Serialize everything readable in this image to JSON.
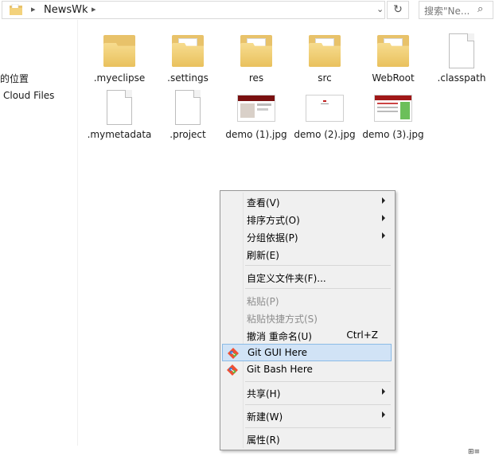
{
  "address": {
    "path_segment": "NewsWk",
    "sep": "▸",
    "dropdown": "⌄",
    "refresh": "↻",
    "search_placeholder": "搜索\"Ne...",
    "search_icon": "⌕"
  },
  "nav": {
    "items": [
      "的位置",
      "Cloud Files"
    ]
  },
  "files": [
    {
      "name": ".myeclipse",
      "type": "folder"
    },
    {
      "name": ".settings",
      "type": "folder"
    },
    {
      "name": "res",
      "type": "folder"
    },
    {
      "name": "src",
      "type": "folder"
    },
    {
      "name": "WebRoot",
      "type": "folder"
    },
    {
      "name": ".classpath",
      "type": "file"
    },
    {
      "name": ".mymetadata",
      "type": "file"
    },
    {
      "name": ".project",
      "type": "file"
    },
    {
      "name": "demo (1).jpg",
      "type": "image"
    },
    {
      "name": "demo (2).jpg",
      "type": "image"
    },
    {
      "name": "demo (3).jpg",
      "type": "image"
    }
  ],
  "context_menu": {
    "items": [
      {
        "label": "查看(V)",
        "submenu": true
      },
      {
        "label": "排序方式(O)",
        "submenu": true
      },
      {
        "label": "分组依据(P)",
        "submenu": true
      },
      {
        "label": "刷新(E)"
      },
      {
        "label": "自定义文件夹(F)..."
      },
      {
        "label": "粘贴(P)",
        "disabled": true
      },
      {
        "label": "粘贴快捷方式(S)",
        "disabled": true
      },
      {
        "label": "撤消 重命名(U)",
        "shortcut": "Ctrl+Z"
      },
      {
        "label": "Git GUI Here",
        "icon": "git-icon",
        "highlighted": true
      },
      {
        "label": "Git Bash Here",
        "icon": "git-icon"
      },
      {
        "label": "共享(H)",
        "submenu": true
      },
      {
        "label": "新建(W)",
        "submenu": true
      },
      {
        "label": "属性(R)"
      }
    ]
  },
  "colors": {
    "menu_bg": "#f0f0f0",
    "highlight_bg": "#d1e3f6",
    "highlight_border": "#8bbbe6",
    "folder": "#e8c26a"
  },
  "status": {
    "view_icons": "⊞≡"
  }
}
